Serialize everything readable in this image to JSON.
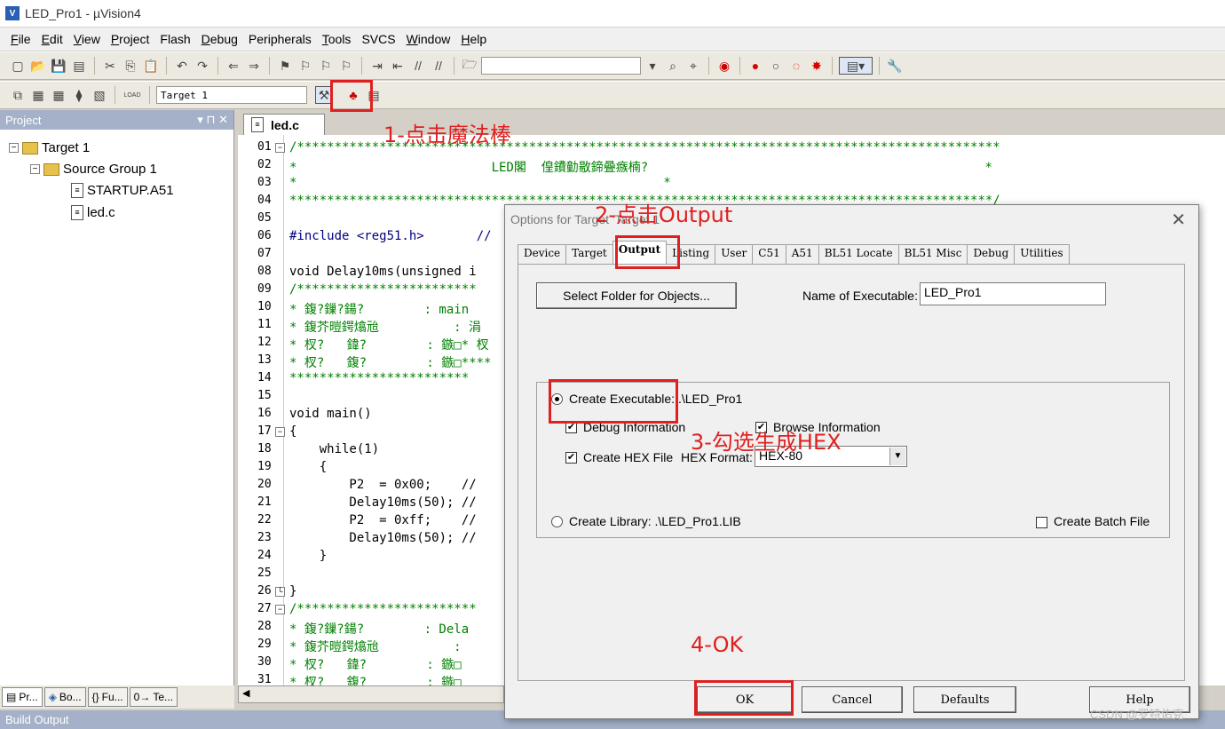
{
  "window": {
    "title": "LED_Pro1  - µVision4"
  },
  "menu": [
    {
      "u": "F",
      "rest": "ile"
    },
    {
      "u": "E",
      "rest": "dit"
    },
    {
      "u": "V",
      "rest": "iew"
    },
    {
      "u": "P",
      "rest": "roject"
    },
    {
      "u": "",
      "rest": "Flash"
    },
    {
      "u": "D",
      "rest": "ebug"
    },
    {
      "u": "",
      "rest": "Peripherals"
    },
    {
      "u": "T",
      "rest": "ools"
    },
    {
      "u": "",
      "rest": "SVCS"
    },
    {
      "u": "W",
      "rest": "indow"
    },
    {
      "u": "H",
      "rest": "elp"
    }
  ],
  "toolbar2": {
    "target_combo": "Target 1",
    "load_label": "LOAD"
  },
  "project": {
    "header": "Project",
    "tree": {
      "target": "Target 1",
      "group": "Source Group 1",
      "file1": "STARTUP.A51",
      "file2": "led.c"
    },
    "tabs": [
      "Pr...",
      "Bo...",
      "Fu...",
      "Te..."
    ]
  },
  "editor": {
    "tab": "led.c",
    "lines": [
      {
        "n": "01",
        "t": "/**********************************************************************************************"
      },
      {
        "n": "02",
        "t": "*                          LED閣  偟鐨勭敭鍗曡瘯楠?                                             *"
      },
      {
        "n": "03",
        "t": "*                                                 *"
      },
      {
        "n": "04",
        "t": "**********************************************************************************************/"
      },
      {
        "n": "05",
        "t": ""
      },
      {
        "n": "06",
        "t": "#include <reg51.h>       //"
      },
      {
        "n": "07",
        "t": ""
      },
      {
        "n": "08",
        "t": "void Delay10ms(unsigned i"
      },
      {
        "n": "09",
        "t": "/************************"
      },
      {
        "n": "10",
        "t": "* 鍑?鏁?鍚?        : main"
      },
      {
        "n": "11",
        "t": "* 鍑芥暟鍔熻兘          : 涓"
      },
      {
        "n": "12",
        "t": "* 杈?   鍏?        : 鏃□* 杈"
      },
      {
        "n": "13",
        "t": "* 杈?   鍑?        : 鏃□****"
      },
      {
        "n": "14",
        "t": "************************"
      },
      {
        "n": "15",
        "t": ""
      },
      {
        "n": "16",
        "t": "void main()"
      },
      {
        "n": "17",
        "t": "{"
      },
      {
        "n": "18",
        "t": "    while(1)"
      },
      {
        "n": "19",
        "t": "    {"
      },
      {
        "n": "20",
        "t": "        P2  = 0x00;    //"
      },
      {
        "n": "21",
        "t": "        Delay10ms(50); //"
      },
      {
        "n": "22",
        "t": "        P2  = 0xff;    //"
      },
      {
        "n": "23",
        "t": "        Delay10ms(50); //"
      },
      {
        "n": "24",
        "t": "    }"
      },
      {
        "n": "25",
        "t": ""
      },
      {
        "n": "26",
        "t": "}"
      },
      {
        "n": "27",
        "t": "/************************"
      },
      {
        "n": "28",
        "t": "* 鍑?鏁?鍚?        : Dela"
      },
      {
        "n": "29",
        "t": "* 鍑芥暟鍔熻兘          :"
      },
      {
        "n": "30",
        "t": "* 杈?   鍏?        : 鏃□"
      },
      {
        "n": "31",
        "t": "* 杈?   鍑?        : 鏃□"
      }
    ]
  },
  "build_output": {
    "header": "Build Output"
  },
  "dialog": {
    "title": "Options for Target 'Target 1'",
    "tabs": [
      "Device",
      "Target",
      "Output",
      "Listing",
      "User",
      "C51",
      "A51",
      "BL51 Locate",
      "BL51 Misc",
      "Debug",
      "Utilities"
    ],
    "active_tab": "Output",
    "select_folder_button": "Select Folder for Objects...",
    "name_exec_label": "Name of Executable:",
    "name_exec_value": "LED_Pro1",
    "create_exec_label": "Create Executable:  .\\LED_Pro1",
    "debug_info_label": "Debug Information",
    "browse_info_label": "Browse Information",
    "create_hex_label": "Create HEX File",
    "hex_format_label": "HEX Format:",
    "hex_format_value": "HEX-80",
    "create_lib_label": "Create Library:  .\\LED_Pro1.LIB",
    "create_batch_label": "Create Batch File",
    "checks": {
      "debug_info": true,
      "browse_info": true,
      "create_hex": true,
      "create_batch": false
    },
    "radio_selected": "create_executable",
    "buttons": {
      "ok": "OK",
      "cancel": "Cancel",
      "defaults": "Defaults",
      "help": "Help"
    }
  },
  "annotations": {
    "step1": "1-点击魔法棒",
    "step2": "2-点击Output",
    "step3": "3-勾选生成HEX",
    "step4": "4-OK"
  },
  "watermark": "CSDN @罗特佑克",
  "colors": {
    "annotation_red": "#e02020",
    "panel_header": "#a5b1c9",
    "comment_green": "#008000"
  }
}
